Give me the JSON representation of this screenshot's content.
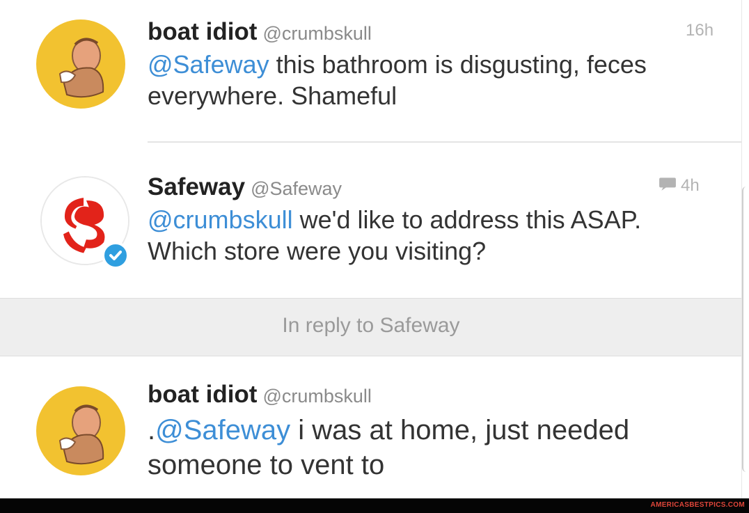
{
  "tweets": [
    {
      "display_name": "boat idiot",
      "handle": "@crumbskull",
      "time": "16h",
      "mention": "@Safeway",
      "text": " this bathroom is disgusting, feces everywhere. Shameful",
      "avatar_icon": "cartoon-character-avatar-icon"
    },
    {
      "display_name": "Safeway",
      "handle": "@Safeway",
      "time": "4h",
      "mention": "@crumbskull",
      "text": " we'd like to address this ASAP. Which store were you visiting?",
      "avatar_icon": "safeway-logo-icon",
      "verified": true,
      "brand_color": "#e2231a",
      "verified_color": "#2f9fe0"
    },
    {
      "display_name": "boat idiot",
      "handle": "@crumbskull",
      "mention_prefix": ".",
      "mention": "@Safeway",
      "text": " i was at home, just needed someone to vent to",
      "avatar_icon": "cartoon-character-avatar-icon"
    }
  ],
  "reply_context": "In reply to Safeway",
  "watermark": "AMERICASBESTPICS.COM",
  "colors": {
    "link": "#3d8ed6",
    "avatar_yellow": "#f2c230",
    "reply_bar_bg": "#eeeeee"
  }
}
